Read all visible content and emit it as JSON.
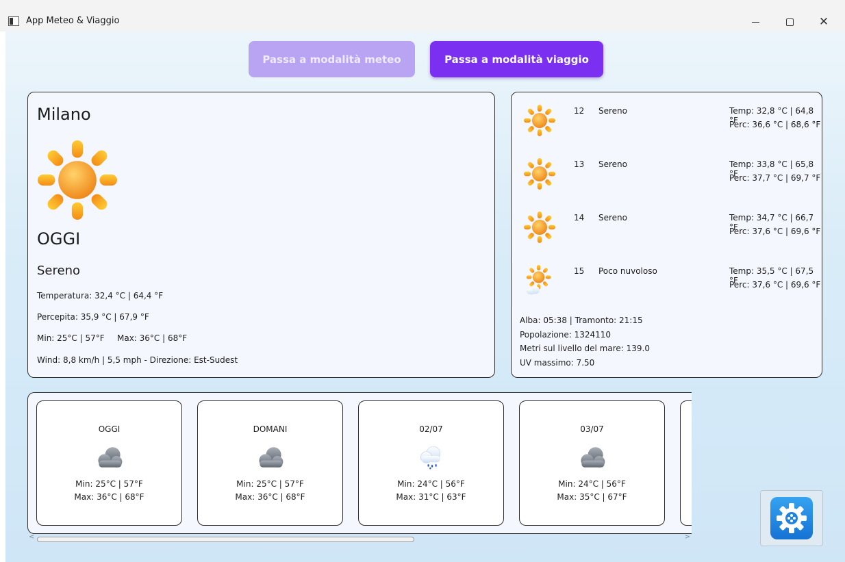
{
  "window": {
    "title": "App Meteo & Viaggio"
  },
  "mode": {
    "meteo_label": "Passa a modalità meteo",
    "viaggio_label": "Passa a modalità viaggio"
  },
  "today": {
    "city": "Milano",
    "day_label": "OGGI",
    "condition": "Sereno",
    "temperature": "Temperatura: 32,4 °C | 64,4 °F",
    "perceived": "Percepita: 35,9 °C | 67,9 °F",
    "min": "Min: 25°C | 57°F",
    "max": "Max: 36°C | 68°F",
    "wind": "Wind: 8,8 km/h | 5,5 mph - Direzione: Est-Sudest",
    "icon": "sun-icon"
  },
  "hourly": [
    {
      "hour": "12",
      "desc": "Sereno",
      "temp": "Temp: 32,8 °C | 64,8 °F",
      "perc": "Perc: 36,6 °C | 68,6 °F",
      "icon": "sun-icon"
    },
    {
      "hour": "13",
      "desc": "Sereno",
      "temp": "Temp: 33,8 °C | 65,8 °F",
      "perc": "Perc: 37,7 °C | 69,7 °F",
      "icon": "sun-icon"
    },
    {
      "hour": "14",
      "desc": "Sereno",
      "temp": "Temp: 34,7 °C | 66,7 °F",
      "perc": "Perc: 37,6 °C | 69,6 °F",
      "icon": "sun-icon"
    },
    {
      "hour": "15",
      "desc": "Poco nuvoloso",
      "temp": "Temp: 35,5 °C | 67,5 °F",
      "perc": "Perc: 37,6 °C | 69,6 °F",
      "icon": "sun-cloud-icon"
    }
  ],
  "city_info": {
    "sun": "Alba: 05:38 | Tramonto: 21:15",
    "population": "Popolazione: 1324110",
    "altitude": "Metri sul livello del mare: 139.0",
    "uv": "UV massimo: 7.50"
  },
  "daily": [
    {
      "title": "OGGI",
      "min": "Min: 25°C | 57°F",
      "max": "Max: 36°C | 68°F",
      "icon": "cloud-icon"
    },
    {
      "title": "DOMANI",
      "min": "Min: 25°C | 57°F",
      "max": "Max: 36°C | 68°F",
      "icon": "cloud-icon"
    },
    {
      "title": "02/07",
      "min": "Min: 24°C | 56°F",
      "max": "Max: 31°C | 63°F",
      "icon": "rain-cloud-icon"
    },
    {
      "title": "03/07",
      "min": "Min: 24°C | 56°F",
      "max": "Max: 35°C | 67°F",
      "icon": "cloud-icon"
    }
  ],
  "colors": {
    "accent": "#7b2ff0",
    "accent_disabled": "#b8a4f3",
    "sun_core": "#f5a623",
    "sun_ray": "#f8b51f"
  }
}
